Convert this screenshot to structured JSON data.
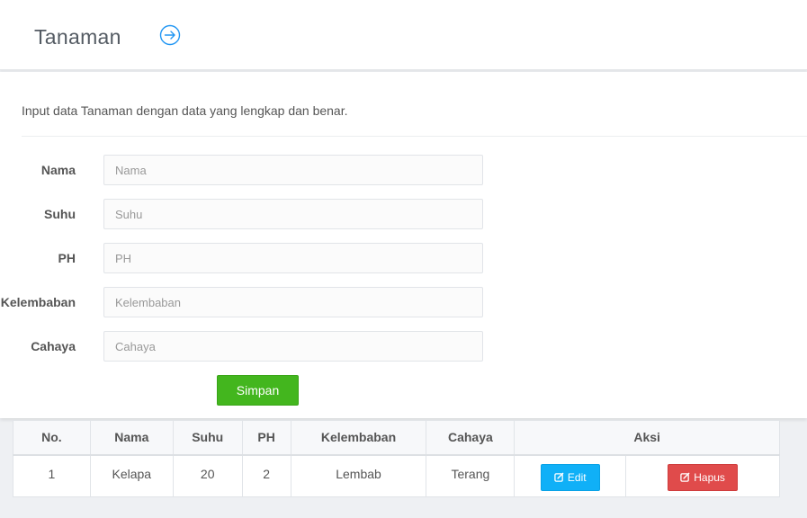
{
  "header": {
    "title": "Tanaman",
    "arrow_icon": "arrow-right-circle-icon"
  },
  "form": {
    "intro": "Input data Tanaman dengan data yang lengkap dan benar.",
    "fields": [
      {
        "label": "Nama",
        "placeholder": "Nama",
        "value": ""
      },
      {
        "label": "Suhu",
        "placeholder": "Suhu",
        "value": ""
      },
      {
        "label": "PH",
        "placeholder": "PH",
        "value": ""
      },
      {
        "label": "Kelembaban",
        "placeholder": "Kelembaban",
        "value": ""
      },
      {
        "label": "Cahaya",
        "placeholder": "Cahaya",
        "value": ""
      }
    ],
    "submit_label": "Simpan"
  },
  "table": {
    "headers": [
      "No.",
      "Nama",
      "Suhu",
      "PH",
      "Kelembaban",
      "Cahaya",
      "Aksi"
    ],
    "rows": [
      {
        "no": "1",
        "nama": "Kelapa",
        "suhu": "20",
        "ph": "2",
        "kelembaban": "Lembab",
        "cahaya": "Terang",
        "edit_label": "Edit",
        "hapus_label": "Hapus"
      }
    ]
  },
  "colors": {
    "accent": "#2196f3",
    "success": "#43b61e",
    "info": "#10b0f7",
    "danger": "#e04b4b"
  }
}
